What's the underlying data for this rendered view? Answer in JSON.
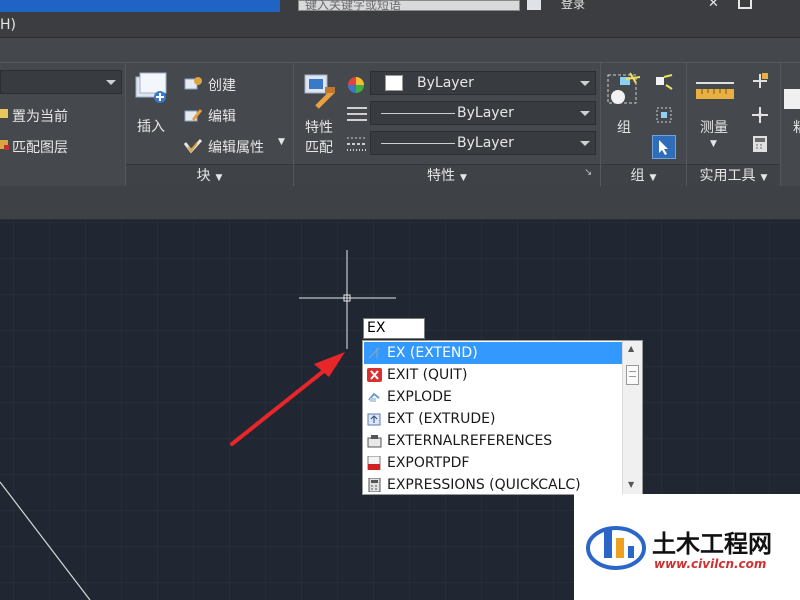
{
  "titlebar": {
    "search_text": "键入关键字或短语",
    "login_label": "登录",
    "close_glyph": "✕"
  },
  "menubar": {
    "help_menu": "H)"
  },
  "ribbon": {
    "layers": {
      "set_current": "置为当前",
      "match_layer": "匹配图层"
    },
    "block": {
      "insert": "插入",
      "create": "创建",
      "edit": "编辑",
      "edit_attributes": "编辑属性",
      "footer": "块"
    },
    "properties": {
      "match": "特性\n匹配",
      "match_line1": "特性",
      "match_line2": "匹配",
      "color": "ByLayer",
      "linetype": "ByLayer",
      "lineweight": "ByLayer",
      "footer": "特性"
    },
    "groups": {
      "group": "组",
      "footer": "组"
    },
    "utilities": {
      "measure": "测量",
      "footer": "实用工具"
    },
    "clipped_label": "粘"
  },
  "command": {
    "input_value": "EX",
    "suggestions": [
      {
        "label": "EX (EXTEND)",
        "icon": "extend-icon",
        "selected": true
      },
      {
        "label": "EXIT (QUIT)",
        "icon": "exit-icon",
        "selected": false
      },
      {
        "label": "EXPLODE",
        "icon": "explode-icon",
        "selected": false
      },
      {
        "label": "EXT (EXTRUDE)",
        "icon": "extrude-icon",
        "selected": false
      },
      {
        "label": "EXTERNALREFERENCES",
        "icon": "xref-icon",
        "selected": false
      },
      {
        "label": "EXPORTPDF",
        "icon": "pdf-icon",
        "selected": false
      },
      {
        "label": "EXPRESSIONS (QUICKCALC)",
        "icon": "calculator-icon",
        "selected": false
      }
    ]
  },
  "watermark": {
    "title": "土木工程网",
    "url": "www.civilcn.com"
  },
  "colors": {
    "canvas": "#202632",
    "ribbon": "#45484c",
    "selection": "#3399ff",
    "arrow": "#e8262a",
    "accent": "#1f64c4"
  }
}
